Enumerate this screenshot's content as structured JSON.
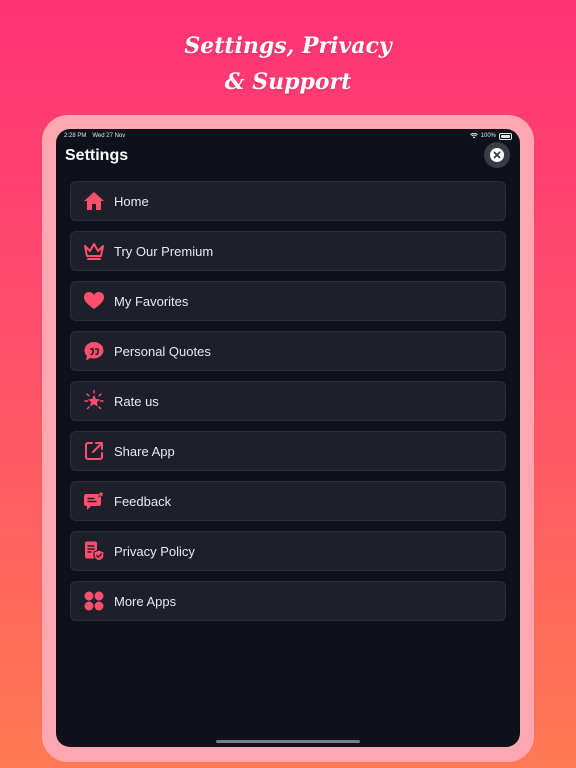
{
  "headline": {
    "line1": "Settings, Privacy",
    "line2": "& Support"
  },
  "status_bar": {
    "time": "2:28 PM",
    "date": "Wed 27 Nov",
    "battery": "100%"
  },
  "header": {
    "title": "Settings"
  },
  "menu": {
    "items": [
      {
        "label": "Home",
        "icon": "home-icon"
      },
      {
        "label": "Try Our Premium",
        "icon": "crown-icon"
      },
      {
        "label": "My Favorites",
        "icon": "heart-icon"
      },
      {
        "label": "Personal Quotes",
        "icon": "quote-bubble-icon"
      },
      {
        "label": "Rate us",
        "icon": "star-burst-icon"
      },
      {
        "label": "Share App",
        "icon": "share-icon"
      },
      {
        "label": "Feedback",
        "icon": "feedback-icon"
      },
      {
        "label": "Privacy Policy",
        "icon": "privacy-shield-icon"
      },
      {
        "label": "More Apps",
        "icon": "apps-grid-icon"
      }
    ]
  },
  "colors": {
    "accent": "#ff4f6d",
    "card": "#1d202b",
    "screen": "#0e111a"
  }
}
